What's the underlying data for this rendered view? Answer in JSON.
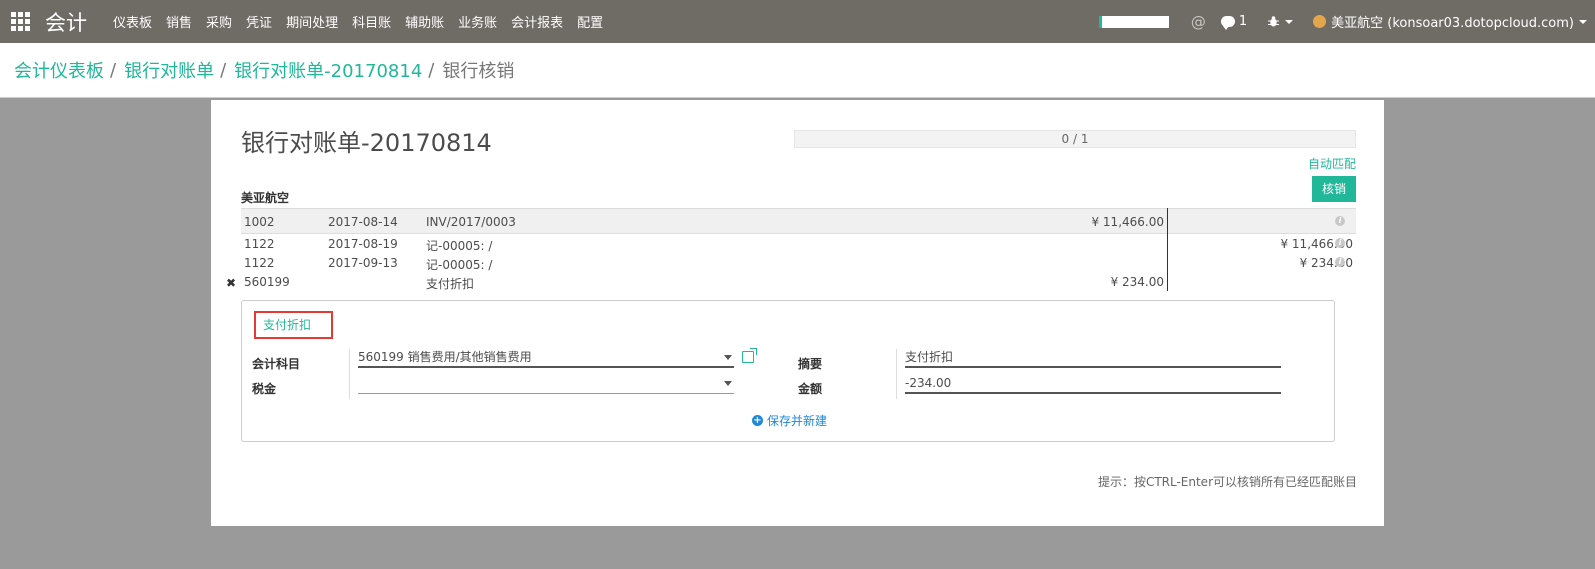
{
  "navbar": {
    "app_title": "会计",
    "menu": [
      "仪表板",
      "销售",
      "采购",
      "凭证",
      "期间处理",
      "科目账",
      "辅助账",
      "业务账",
      "会计报表",
      "配置"
    ],
    "at_symbol": "@",
    "chat_count": "1",
    "user": "美亚航空 (konsoar03.dotopcloud.com)"
  },
  "breadcrumb": {
    "items": [
      "会计仪表板",
      "银行对账单",
      "银行对账单-20170814"
    ],
    "separator": "/",
    "current": "银行核销"
  },
  "statement": {
    "title": "银行对账单-20170814",
    "progress": "0 / 1",
    "progress_fraction": 0,
    "auto_match": "自动匹配",
    "reconcile_button": "核销",
    "partner": "美亚航空"
  },
  "lines": [
    {
      "account": "1002",
      "date": "2017-08-14",
      "ref": "INV/2017/0003",
      "debit": "¥ 11,466.00",
      "credit": ""
    },
    {
      "account": "1122",
      "date": "2017-08-19",
      "ref": "记-00005: /",
      "debit": "",
      "credit": "¥ 11,466.00"
    },
    {
      "account": "1122",
      "date": "2017-09-13",
      "ref": "记-00005: /",
      "debit": "",
      "credit": "¥ 234.00"
    },
    {
      "account": "560199",
      "date": "",
      "ref": "支付折扣",
      "debit": "¥ 234.00",
      "credit": ""
    }
  ],
  "remove_symbol": "✖",
  "info_symbol": "i",
  "panel": {
    "tab_label": "支付折扣",
    "account_label": "会计科目",
    "account_value": "560199 销售费用/其他销售费用",
    "tax_label": "税金",
    "tax_value": "",
    "desc_label": "摘要",
    "desc_value": "支付折扣",
    "amount_label": "金额",
    "amount_value": "-234.00",
    "save_new": "保存并新建",
    "plus_symbol": "+"
  },
  "hint": "提示：按CTRL-Enter可以核销所有已经匹配账目",
  "colors": {
    "navbar": "#6f6b65",
    "accent": "#21b799",
    "highlight_border": "#e53935",
    "link_blue": "#1e88d6"
  }
}
